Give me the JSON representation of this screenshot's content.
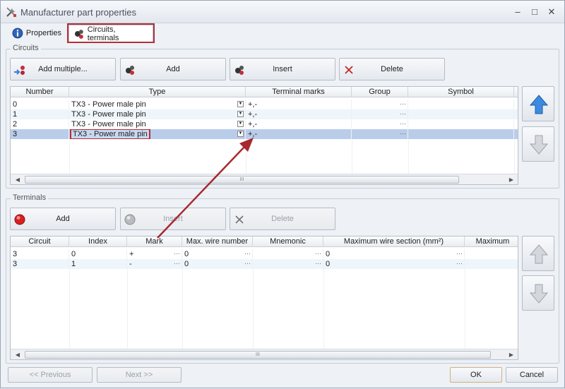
{
  "window": {
    "title": "Manufacturer part properties"
  },
  "tabs": [
    {
      "label": "Properties"
    },
    {
      "label": "Circuits, terminals"
    }
  ],
  "circuits": {
    "group_title": "Circuits",
    "buttons": {
      "add_multiple": "Add multiple...",
      "add": "Add",
      "insert": "Insert",
      "delete": "Delete"
    },
    "columns": [
      "Number",
      "Type",
      "Terminal marks",
      "Group",
      "Symbol"
    ],
    "rows": [
      {
        "number": "0",
        "type": "TX3 - Power male pin",
        "marks": "+,-"
      },
      {
        "number": "1",
        "type": "TX3 - Power male pin",
        "marks": "+,-"
      },
      {
        "number": "2",
        "type": "TX3 - Power male pin",
        "marks": "+,-"
      },
      {
        "number": "3",
        "type": "TX3 - Power male pin",
        "marks": "+,-"
      }
    ],
    "ellipsis": "···",
    "scroll_grip": "III"
  },
  "terminals": {
    "group_title": "Terminals",
    "buttons": {
      "add": "Add",
      "insert": "Insert",
      "delete": "Delete"
    },
    "columns": [
      "Circuit",
      "Index",
      "Mark",
      "Max. wire number",
      "Mnemonic",
      "Maximum wire section (mm²)",
      "Maximum"
    ],
    "rows": [
      {
        "circuit": "3",
        "index": "0",
        "mark": "+",
        "max_wire_number": "0",
        "mnemonic": "",
        "max_section": "0"
      },
      {
        "circuit": "3",
        "index": "1",
        "mark": "-",
        "max_wire_number": "0",
        "mnemonic": "",
        "max_section": "0"
      }
    ]
  },
  "footer": {
    "previous": "<< Previous",
    "next": "Next >>",
    "ok": "OK",
    "cancel": "Cancel"
  },
  "colors": {
    "highlight": "#b23038",
    "selected_row": "#b9cdeb",
    "arrow_blue": "#3d8be0"
  }
}
